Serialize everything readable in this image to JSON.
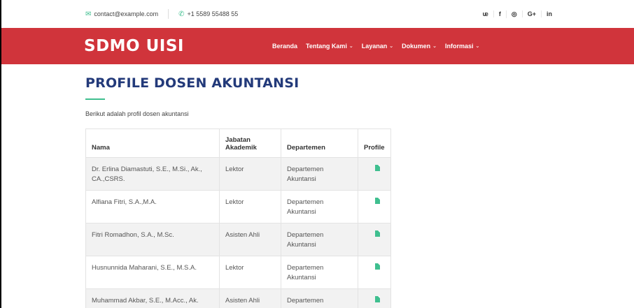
{
  "topbar": {
    "email": "contact@example.com",
    "phone": "+1 5589 55488 55",
    "social": [
      "twitter-icon",
      "facebook-icon",
      "instagram-icon",
      "google-plus-icon",
      "linkedin-icon"
    ],
    "social_glyphs": [
      "𝕪",
      "f",
      "◎",
      "G+",
      "in"
    ]
  },
  "header": {
    "brand": "SDMO UISI",
    "nav": [
      {
        "label": "Beranda",
        "dropdown": false
      },
      {
        "label": "Tentang Kami",
        "dropdown": true
      },
      {
        "label": "Layanan",
        "dropdown": true
      },
      {
        "label": "Dokumen",
        "dropdown": true
      },
      {
        "label": "Informasi",
        "dropdown": true
      }
    ]
  },
  "main": {
    "title": "PROFILE DOSEN AKUNTANSI",
    "intro": "Berikut adalah profil dosen akuntansi"
  },
  "table": {
    "headers": {
      "nama": "Nama",
      "jabatan_line1": "Jabatan",
      "jabatan_line2": "Akademik",
      "departemen": "Departemen",
      "profile": "Profile"
    },
    "rows": [
      {
        "nama": "Dr. Erlina Diamastuti, S.E., M.Si., Ak., CA.,CSRS.",
        "jabatan": "Lektor",
        "departemen": "Departemen Akuntansi"
      },
      {
        "nama": "Alfiana Fitri, S.A.,M.A.",
        "jabatan": "Lektor",
        "departemen": "Departemen Akuntansi"
      },
      {
        "nama": "Fitri Romadhon, S.A., M.Sc.",
        "jabatan": "Asisten Ahli",
        "departemen": "Departemen Akuntansi"
      },
      {
        "nama": "Husnunnida Maharani, S.E., M.S.A.",
        "jabatan": "Lektor",
        "departemen": "Departemen Akuntansi"
      },
      {
        "nama": "Muhammad Akbar, S.E., M.Acc., Ak.",
        "jabatan": "Asisten Ahli",
        "departemen": "Departemen"
      }
    ]
  },
  "colors": {
    "header_bg": "#d0343b",
    "title": "#233a7a",
    "accent": "#3fbf8f"
  }
}
